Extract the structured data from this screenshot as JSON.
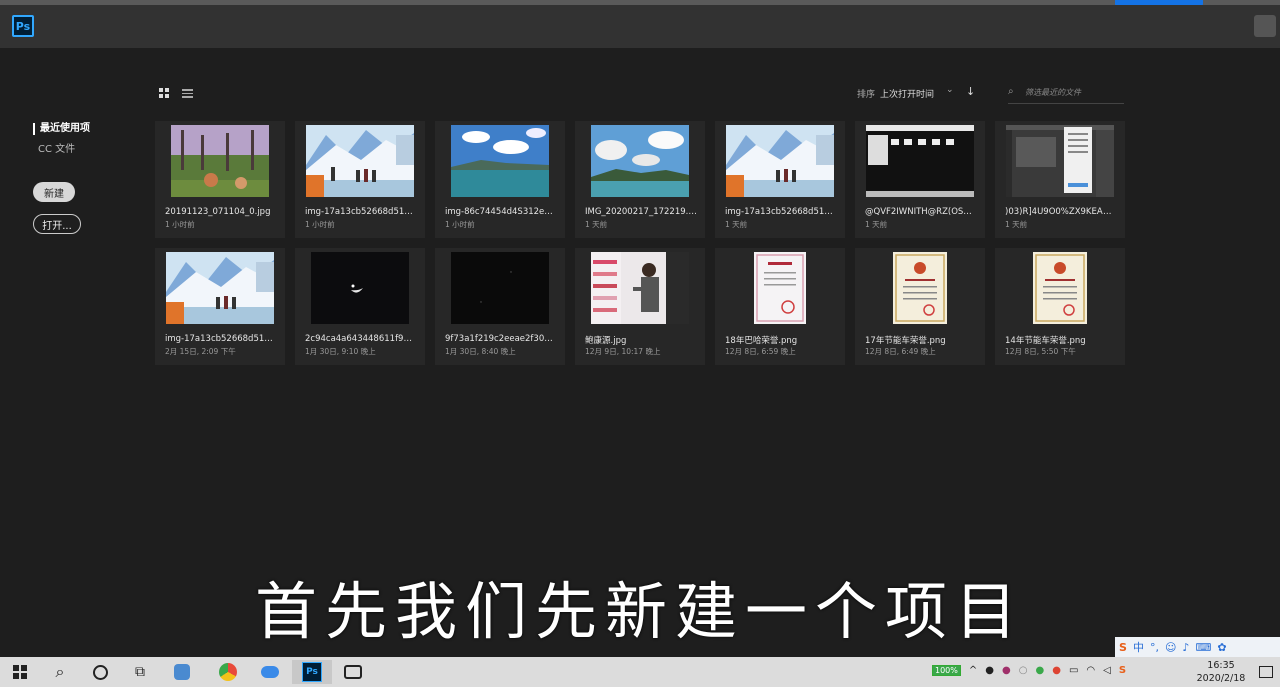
{
  "app": {
    "logo_text": "Ps"
  },
  "sidebar": {
    "recent_label": "最近使用项",
    "cc_label": "CC 文件",
    "new_button": "新建",
    "open_button": "打开..."
  },
  "toolbar": {
    "sort_label": "排序",
    "sort_value": "上次打开时间",
    "search_placeholder": "筛选最近的文件"
  },
  "files": [
    {
      "name": "20191123_071104_0.jpg",
      "time": "1 小时前"
    },
    {
      "name": "img-17a13cb52668d511dfe1...",
      "time": "1 小时前"
    },
    {
      "name": "img-86c74454d4S312e0290...",
      "time": "1 小时前"
    },
    {
      "name": "IMG_20200217_172219.jpg",
      "time": "1 天前"
    },
    {
      "name": "img-17a13cb52668d511dfe1...",
      "time": "1 天前"
    },
    {
      "name": "@QVF2IWNITH@RZ(OSB...",
      "time": "1 天前"
    },
    {
      "name": ")03)R]4U9O0%ZX9KEAA6...",
      "time": "1 天前"
    },
    {
      "name": "img-17a13cb52668d511dfe1...",
      "time": "2月 15日, 2:09 下午"
    },
    {
      "name": "2c94ca4a643448611f95bb...",
      "time": "1月 30日, 9:10 晚上"
    },
    {
      "name": "9f73a1f219c2eeae2f30808...",
      "time": "1月 30日, 8:40 晚上"
    },
    {
      "name": "鲍康源.jpg",
      "time": "12月 9日, 10:17 晚上"
    },
    {
      "name": "18年巴哈荣誉.png",
      "time": "12月 8日, 6:59 晚上"
    },
    {
      "name": "17年节能车荣誉.png",
      "time": "12月 8日, 6:49 晚上"
    },
    {
      "name": "14年节能车荣誉.png",
      "time": "12月 8日, 5:50 下午"
    }
  ],
  "subtitle": "首先我们先新建一个项目",
  "taskbar": {
    "battery": "100%",
    "time": "16:35",
    "date": "2020/2/18"
  },
  "colors": {
    "accent": "#31a8ff",
    "bg": "#1e1e1e",
    "card": "#272727"
  }
}
